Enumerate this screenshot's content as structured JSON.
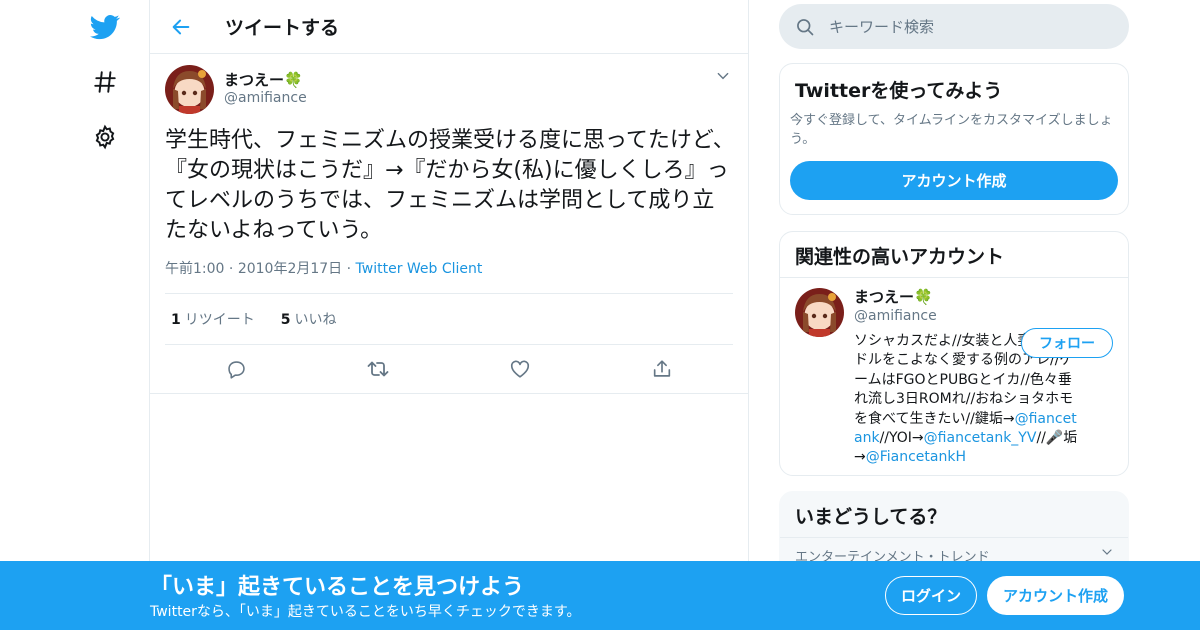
{
  "colors": {
    "accent": "#1da1f2",
    "link": "#1b95e0",
    "secondary_text": "#657786",
    "border": "#e6ecf0"
  },
  "nav": {
    "icons": [
      "twitter-bird-icon",
      "hashtag-icon",
      "gear-icon"
    ]
  },
  "header": {
    "title": "ツイートする"
  },
  "tweet": {
    "author_name": "まつえー🍀",
    "author_handle": "@amifiance",
    "text": "学生時代、フェミニズムの授業受ける度に思ってたけど、『女の現状はこうだ』→『だから女(私)に優しくしろ』ってレベルのうちでは、フェミニズムは学問として成り立たないよねっていう。",
    "time": "午前1:00",
    "date": "2010年2月17日",
    "client": "Twitter Web Client",
    "retweets_count": "1",
    "retweets_label": "リツイート",
    "likes_count": "5",
    "likes_label": "いいね"
  },
  "search": {
    "placeholder": "キーワード検索"
  },
  "signup_card": {
    "title": "Twitterを使ってみよう",
    "subtitle": "今すぐ登録して、タイムラインをカスタマイズしましょう。",
    "button": "アカウント作成"
  },
  "related": {
    "title": "関連性の高いアカウント",
    "name": "まつえー🍀",
    "handle": "@amifiance",
    "follow": "フォロー",
    "bio_text1": "ソシャカスだよ//女装と人妻とアイドルをこよなく愛する例のアレ//ゲームはFGOとPUBGとイカ//色々垂れ流し3日ROMれ//おねショタホモを食べて生きたい//鍵垢→",
    "bio_link1": "@fiancetank",
    "bio_text2": "//YOI→",
    "bio_link2": "@fiancetank_YV",
    "bio_text3": "//🎤垢→",
    "bio_link3": "@FiancetankH"
  },
  "trends": {
    "title": "いまどうしてる？",
    "first": "エンターテインメント・トレンド"
  },
  "banner": {
    "title": "「いま」起きていることを見つけよう",
    "subtitle": "Twitterなら、「いま」起きていることをいち早くチェックできます。",
    "login": "ログイン",
    "signup": "アカウント作成"
  }
}
